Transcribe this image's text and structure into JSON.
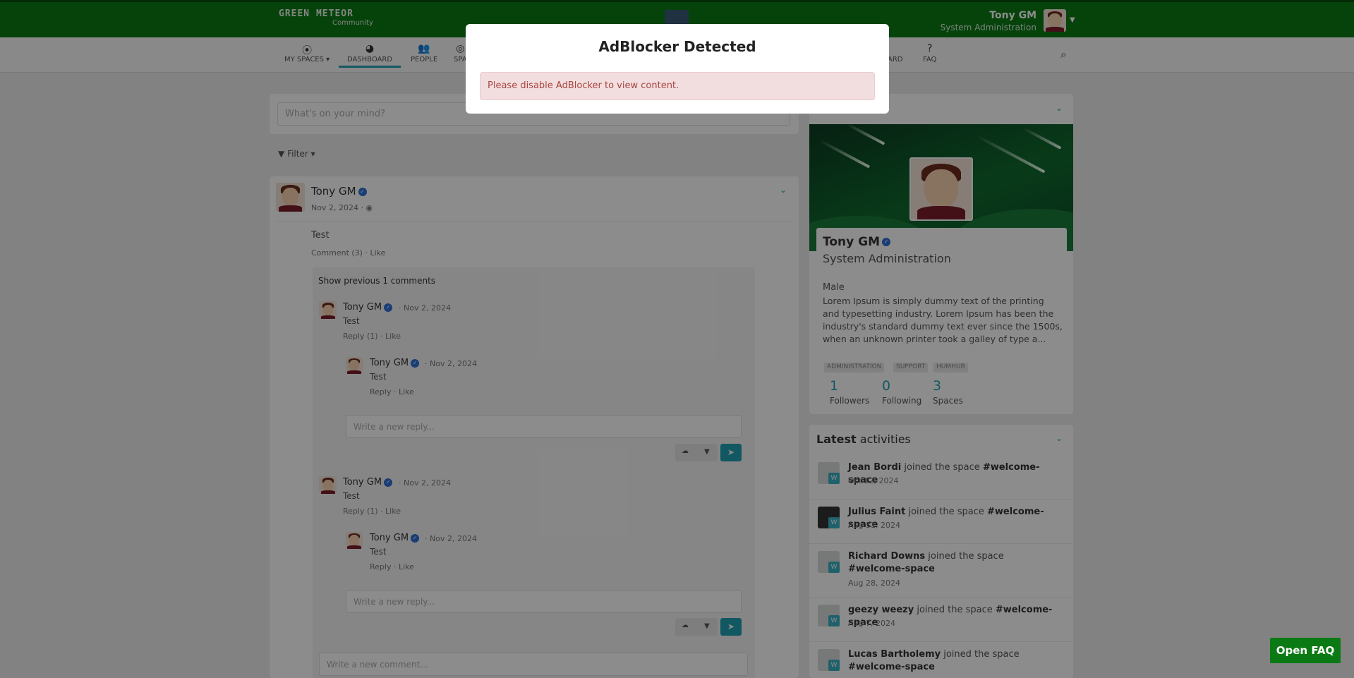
{
  "header": {
    "logo": "GREEN METEOR",
    "logo_sub": "Community",
    "user_name": "Tony GM",
    "user_role": "System Administration"
  },
  "nav": {
    "items": [
      {
        "label": "MY SPACES",
        "icon": "target-icon"
      },
      {
        "label": "DASHBOARD",
        "icon": "dashboard-icon"
      },
      {
        "label": "PEOPLE",
        "icon": "people-icon"
      },
      {
        "label": "SPA",
        "icon": "spaces-icon"
      },
      {
        "label": "ARD",
        "icon": "board-icon"
      },
      {
        "label": "FAQ",
        "icon": "question-icon"
      }
    ]
  },
  "stream": {
    "post_placeholder": "What's on your mind?",
    "filter_label": "Filter",
    "post": {
      "author": "Tony GM",
      "date": "Nov 2, 2024 ·",
      "text": "Test",
      "comment_link": "Comment (3)",
      "like_link": "Like"
    },
    "show_previous": "Show previous 1 comments",
    "comments": [
      {
        "author": "Tony GM",
        "date": "· Nov 2, 2024",
        "text": "Test",
        "reply_link": "Reply (1)",
        "like_link": "Like",
        "reply": {
          "author": "Tony GM",
          "date": "· Nov 2, 2024",
          "text": "Test",
          "reply_link": "Reply",
          "like_link": "Like"
        },
        "reply_placeholder": "Write a new reply..."
      },
      {
        "author": "Tony GM",
        "date": "· Nov 2, 2024",
        "text": "Test",
        "reply_link": "Reply (1)",
        "like_link": "Like",
        "reply": {
          "author": "Tony GM",
          "date": "· Nov 2, 2024",
          "text": "Test",
          "reply_link": "Reply",
          "like_link": "Like"
        },
        "reply_placeholder": "Write a new reply..."
      }
    ],
    "comment_placeholder": "Write a new comment..."
  },
  "profile": {
    "name": "Tony GM",
    "role": "System Administration",
    "gender": "Male",
    "about": "Lorem Ipsum is simply dummy text of the printing and typesetting industry. Lorem Ipsum has been the industry's standard dummy text ever since the 1500s, when an unknown printer took a galley of type a...",
    "tags": [
      "ADMINISTRATION",
      "SUPPORT",
      "HUMHUB"
    ],
    "stats": [
      {
        "value": "1",
        "label": "Followers"
      },
      {
        "value": "0",
        "label": "Following"
      },
      {
        "value": "3",
        "label": "Spaces"
      }
    ]
  },
  "activities": {
    "title_bold": "Latest",
    "title_rest": " activities",
    "items": [
      {
        "user": "Jean Bordi",
        "action": " joined the space ",
        "space": "#welcome-space",
        "date": "Oct 12, 2024"
      },
      {
        "user": "Julius Faint",
        "action": " joined the space ",
        "space": "#welcome-space",
        "date": "Aug 31, 2024"
      },
      {
        "user": "Richard Downs",
        "action": " joined the space ",
        "space": "#welcome-space",
        "date": "Aug 28, 2024"
      },
      {
        "user": "geezy weezy",
        "action": " joined the space ",
        "space": "#welcome-space",
        "date": "Aug 7, 2024"
      },
      {
        "user": "Lucas Bartholemy",
        "action": " joined the space ",
        "space": "#welcome-space",
        "date": ""
      }
    ]
  },
  "modal": {
    "title": "AdBlocker Detected",
    "message": "Please disable AdBlocker to view content."
  },
  "faq_button": "Open FAQ",
  "colors": {
    "brand": "#0b7a14",
    "accent": "#21a1b3",
    "alert_bg": "#f2dede",
    "alert_text": "#a94442"
  }
}
